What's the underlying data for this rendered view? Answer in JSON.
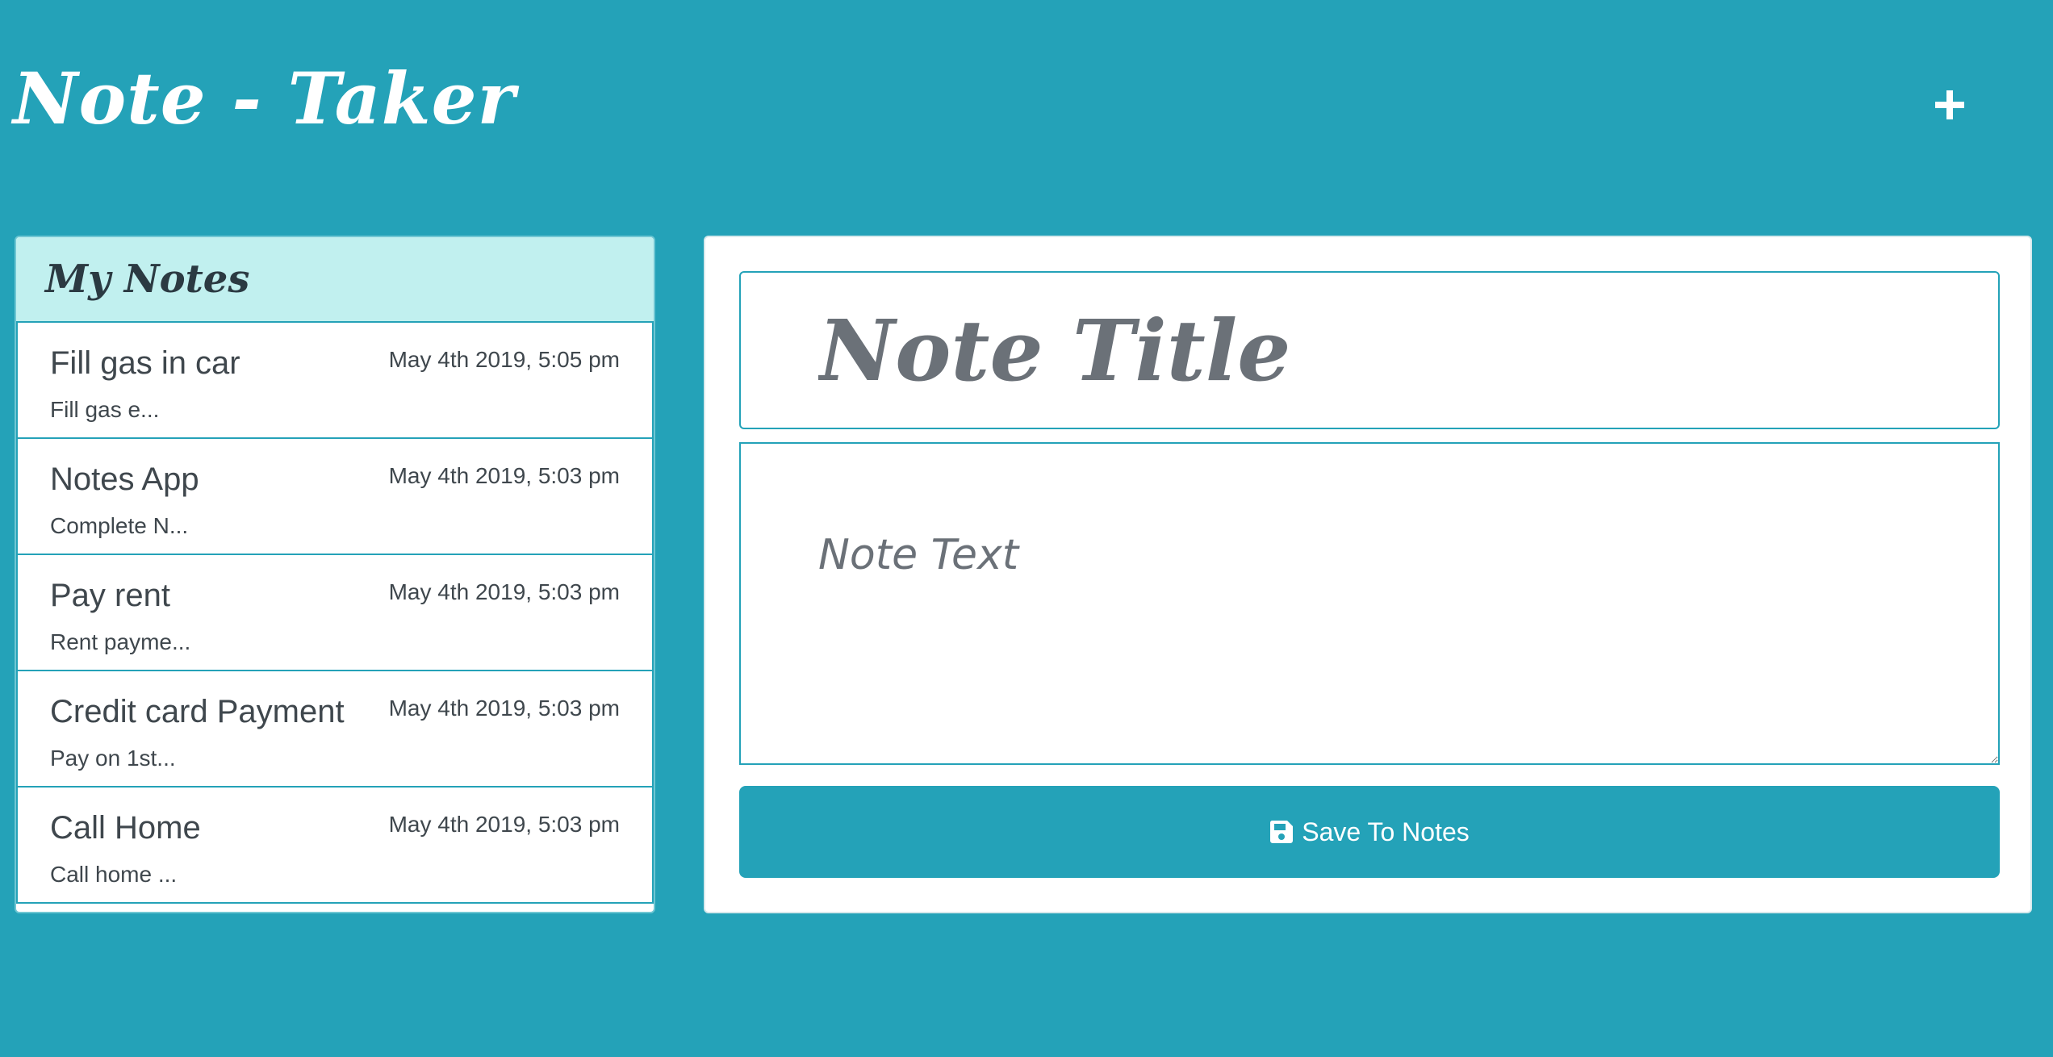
{
  "header": {
    "title": "Note - Taker",
    "new_note_icon": "plus-icon"
  },
  "sidebar": {
    "title": "My Notes",
    "notes": [
      {
        "title": "Fill gas in car",
        "date": "May 4th 2019, 5:05 pm",
        "preview": "Fill gas e..."
      },
      {
        "title": "Notes App",
        "date": "May 4th 2019, 5:03 pm",
        "preview": "Complete N..."
      },
      {
        "title": "Pay rent",
        "date": "May 4th 2019, 5:03 pm",
        "preview": "Rent payme..."
      },
      {
        "title": "Credit card Payment",
        "date": "May 4th 2019, 5:03 pm",
        "preview": "Pay on 1st..."
      },
      {
        "title": "Call Home",
        "date": "May 4th 2019, 5:03 pm",
        "preview": "Call home ..."
      }
    ]
  },
  "editor": {
    "title_placeholder": "Note Title",
    "title_value": "",
    "text_placeholder": "Note Text",
    "text_value": "",
    "save_label": "Save To Notes",
    "save_icon": "floppy-disk-icon"
  },
  "colors": {
    "background": "#24a2b8",
    "accent": "#24a2b8",
    "sidebar_header": "#c1f0ef",
    "text_dark": "#3f474d",
    "placeholder": "#6b7178"
  }
}
